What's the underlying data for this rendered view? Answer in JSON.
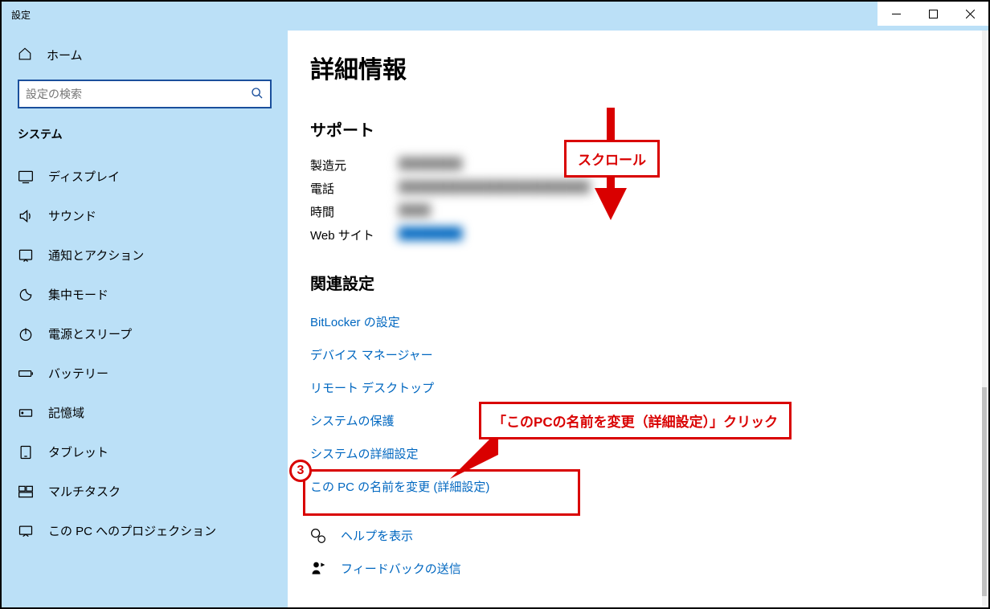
{
  "window": {
    "title": "設定"
  },
  "sidebar": {
    "home": "ホーム",
    "search_placeholder": "設定の検索",
    "category": "システム",
    "items": [
      {
        "label": "ディスプレイ"
      },
      {
        "label": "サウンド"
      },
      {
        "label": "通知とアクション"
      },
      {
        "label": "集中モード"
      },
      {
        "label": "電源とスリープ"
      },
      {
        "label": "バッテリー"
      },
      {
        "label": "記憶域"
      },
      {
        "label": "タブレット"
      },
      {
        "label": "マルチタスク"
      },
      {
        "label": "この PC へのプロジェクション"
      }
    ]
  },
  "main": {
    "title": "詳細情報",
    "support": {
      "heading": "サポート",
      "rows": [
        {
          "label": "製造元",
          "value": "████████"
        },
        {
          "label": "電話",
          "value": "████████████████████████"
        },
        {
          "label": "時間",
          "value": "████"
        },
        {
          "label": "Web サイト",
          "value": "████████",
          "link": true
        }
      ]
    },
    "related": {
      "heading": "関連設定",
      "links": [
        "BitLocker の設定",
        "デバイス マネージャー",
        "リモート デスクトップ",
        "システムの保護",
        "システムの詳細設定",
        "この PC の名前を変更 (詳細設定)"
      ]
    },
    "help": {
      "show_help": "ヘルプを表示",
      "feedback": "フィードバックの送信"
    }
  },
  "annotations": {
    "scroll": "スクロール",
    "rename_click": "「このPCの名前を変更（詳細設定）」クリック",
    "step": "3"
  }
}
